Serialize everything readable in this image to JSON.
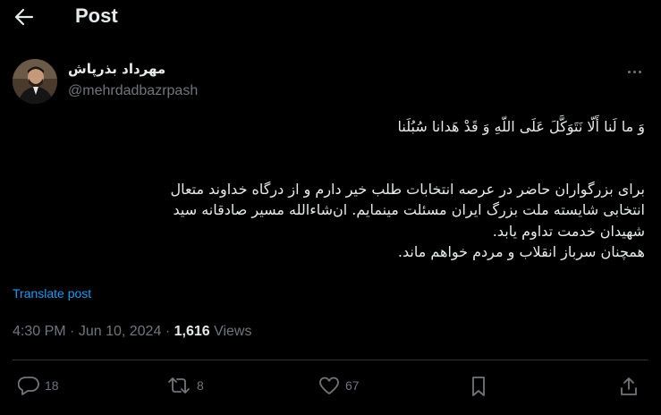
{
  "header": {
    "title": "Post"
  },
  "author": {
    "display_name": "مهرداد بذرپاش",
    "handle": "@mehrdadbazrpash"
  },
  "tweet": {
    "lines_paragraph1": [
      "وَ ما لَنا أَلّا نَتَوَکَّلَ عَلَی اللّهِ وَ قَدْ هَدانا سُبُلَنا"
    ],
    "lines_paragraph2": [
      "برای بزرگواران حاضر در عرصه انتخابات طلب خیر دارم و از درگاه خداوند متعال",
      "انتخابی شایسته ملت بزرگ ایران مسئلت مینمایم. ان‌شاءالله مسیر صادقانه سید",
      "شهیدان خدمت تداوم یابد.",
      "همچنان سرباز انقلاب و مردم خواهم ماند."
    ],
    "translate_label": "Translate post"
  },
  "meta": {
    "time": "4:30 PM",
    "separator": "·",
    "date": "Jun 10, 2024",
    "views_count": "1,616",
    "views_label": "Views"
  },
  "actions": {
    "replies": "18",
    "reposts": "8",
    "likes": "67"
  },
  "colors": {
    "background": "#000000",
    "text": "#e7e9ea",
    "muted": "#71767b",
    "link": "#1d9bf0",
    "divider": "#2f3336"
  }
}
